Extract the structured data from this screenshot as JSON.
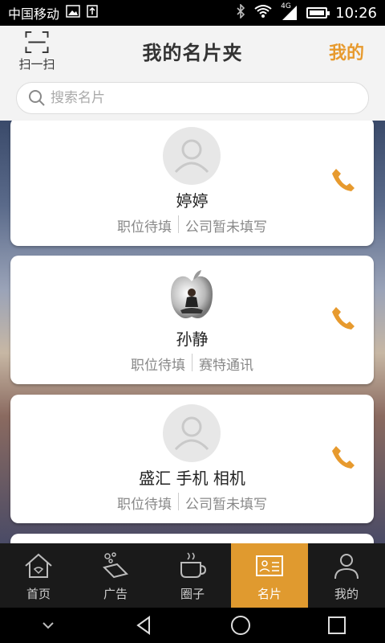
{
  "status_bar": {
    "carrier": "中国移动",
    "network": "4G",
    "time": "10:26"
  },
  "header": {
    "scan_label": "扫一扫",
    "title": "我的名片夹",
    "mine": "我的"
  },
  "search": {
    "placeholder": "搜索名片"
  },
  "cards": [
    {
      "name": "婷婷",
      "position": "职位待填",
      "company": "公司暂未填写",
      "avatar": "default-avatar-icon"
    },
    {
      "name": "孙静",
      "position": "职位待填",
      "company": "赛特通讯",
      "avatar": "apple-meditation-photo"
    },
    {
      "name": "盛汇 手机 相机",
      "position": "职位待填",
      "company": "公司暂未填写",
      "avatar": "default-avatar-icon"
    }
  ],
  "bottom_nav": [
    {
      "label": "首页",
      "icon": "home-icon",
      "active": false
    },
    {
      "label": "广告",
      "icon": "ad-icon",
      "active": false
    },
    {
      "label": "圈子",
      "icon": "coffee-cup-icon",
      "active": false
    },
    {
      "label": "名片",
      "icon": "business-card-icon",
      "active": true
    },
    {
      "label": "我的",
      "icon": "person-icon",
      "active": false
    }
  ],
  "colors": {
    "accent": "#e09a2f",
    "phone": "#e79a2e"
  }
}
